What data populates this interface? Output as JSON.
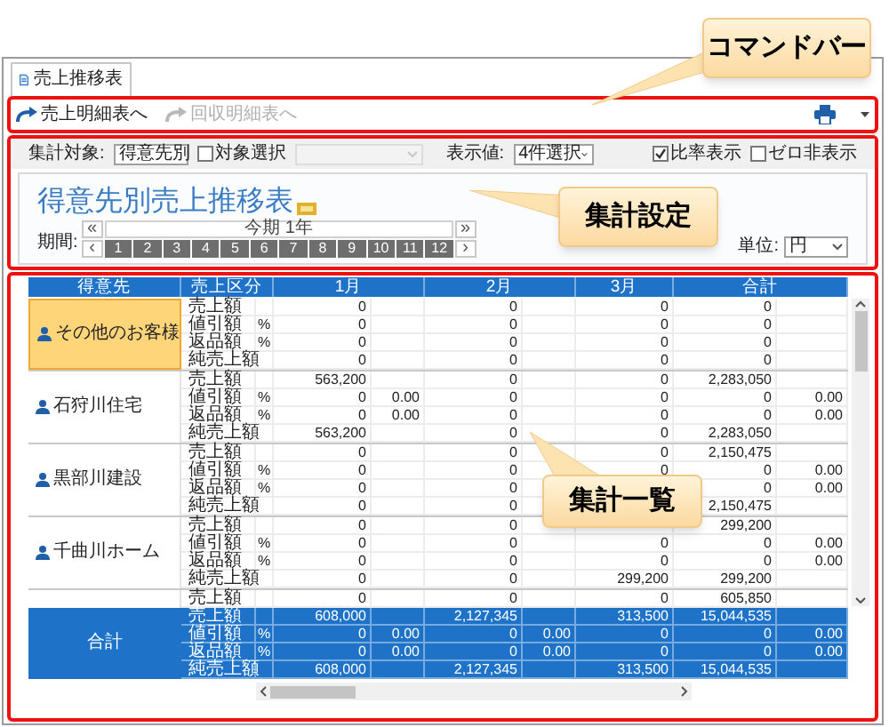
{
  "tab": {
    "label": "売上推移表",
    "selected": true
  },
  "command_bar": {
    "items": [
      {
        "label": "売上明細表へ",
        "disabled": false
      },
      {
        "label": "回収明細表へ",
        "disabled": true
      }
    ]
  },
  "settings": {
    "target": {
      "label": "集計対象:",
      "value": "得意先別"
    },
    "target_select": {
      "label": "対象選択",
      "checked": false
    },
    "target_field": {
      "disabled": true
    },
    "display": {
      "label": "表示値:",
      "value": "4件選択"
    },
    "options": [
      {
        "label": "比率表示",
        "checked": true
      },
      {
        "label": "ゼロ非表示",
        "checked": false
      }
    ],
    "title": "得意先別売上推移表",
    "period": {
      "label": "期間:",
      "range": "今期 1年",
      "first": "«",
      "prev": "‹",
      "next": "›",
      "last": "»",
      "months": [
        "1",
        "2",
        "3",
        "4",
        "5",
        "6",
        "7",
        "8",
        "9",
        "10",
        "11",
        "12"
      ]
    },
    "unit": {
      "label": "単位:",
      "value": "円"
    }
  },
  "table": {
    "columns": [
      "得意先",
      "売上区分",
      "1月",
      "2月",
      "3月",
      "合計"
    ],
    "groups": [
      {
        "customer": "その他のお客様",
        "selected": true,
        "rows": [
          {
            "label": "売上額",
            "cells": [
              "0",
              null,
              "0",
              null,
              "0",
              "0",
              null
            ]
          },
          {
            "label": "値引額",
            "unit": "%",
            "cells": [
              "0",
              null,
              "0",
              null,
              "0",
              "0",
              null
            ]
          },
          {
            "label": "返品額",
            "unit": "%",
            "cells": [
              "0",
              null,
              "0",
              null,
              "0",
              "0",
              null
            ]
          },
          {
            "label": "純売上額",
            "cells": [
              "0",
              null,
              "0",
              null,
              "0",
              "0",
              null
            ]
          }
        ]
      },
      {
        "customer": "石狩川住宅",
        "selected": false,
        "rows": [
          {
            "label": "売上額",
            "cells": [
              "563,200",
              null,
              "0",
              null,
              "0",
              "2,283,050",
              null
            ]
          },
          {
            "label": "値引額",
            "unit": "%",
            "cells": [
              "0",
              "0.00",
              "0",
              null,
              "0",
              "0",
              "0.00"
            ]
          },
          {
            "label": "返品額",
            "unit": "%",
            "cells": [
              "0",
              "0.00",
              "0",
              null,
              "0",
              "0",
              "0.00"
            ]
          },
          {
            "label": "純売上額",
            "cells": [
              "563,200",
              null,
              "0",
              null,
              "0",
              "2,283,050",
              null
            ]
          }
        ]
      },
      {
        "customer": "黒部川建設",
        "selected": false,
        "rows": [
          {
            "label": "売上額",
            "cells": [
              "0",
              null,
              "0",
              null,
              "0",
              "2,150,475",
              null
            ]
          },
          {
            "label": "値引額",
            "unit": "%",
            "cells": [
              "0",
              null,
              "0",
              null,
              "0",
              "0",
              "0.00"
            ]
          },
          {
            "label": "返品額",
            "unit": "%",
            "cells": [
              "0",
              null,
              "0",
              null,
              null,
              "0",
              "0.00"
            ]
          },
          {
            "label": "純売上額",
            "cells": [
              "0",
              null,
              "0",
              null,
              null,
              "2,150,475",
              null
            ]
          }
        ]
      },
      {
        "customer": "千曲川ホーム",
        "selected": false,
        "rows": [
          {
            "label": "売上額",
            "cells": [
              "0",
              null,
              "0",
              null,
              null,
              "299,200",
              null
            ]
          },
          {
            "label": "値引額",
            "unit": "%",
            "cells": [
              "0",
              null,
              "0",
              null,
              "0",
              "0",
              "0.00"
            ]
          },
          {
            "label": "返品額",
            "unit": "%",
            "cells": [
              "0",
              null,
              "0",
              null,
              "0",
              "0",
              "0.00"
            ]
          },
          {
            "label": "純売上額",
            "cells": [
              "0",
              null,
              "0",
              null,
              "299,200",
              "299,200",
              null
            ]
          }
        ]
      },
      {
        "selected": false,
        "rows": [
          {
            "label": "売上額",
            "cells": [
              "0",
              null,
              "0",
              null,
              "0",
              "605,850",
              null
            ]
          }
        ]
      }
    ],
    "total": {
      "customer": "合計",
      "rows": [
        {
          "label": "売上額",
          "cells": [
            "608,000",
            null,
            "2,127,345",
            null,
            "313,500",
            "15,044,535",
            null
          ]
        },
        {
          "label": "値引額",
          "unit": "%",
          "cells": [
            "0",
            "0.00",
            "0",
            "0.00",
            "0",
            "0",
            "0.00"
          ]
        },
        {
          "label": "返品額",
          "unit": "%",
          "cells": [
            "0",
            "0.00",
            "0",
            "0.00",
            "0",
            "0",
            "0.00"
          ]
        },
        {
          "label": "純売上額",
          "cells": [
            "608,000",
            null,
            "2,127,345",
            null,
            "313,500",
            "15,044,535",
            null
          ]
        }
      ]
    }
  },
  "callouts": [
    {
      "text": "コマンドバー"
    },
    {
      "text": "集計設定"
    },
    {
      "text": "集計一覧"
    }
  ]
}
